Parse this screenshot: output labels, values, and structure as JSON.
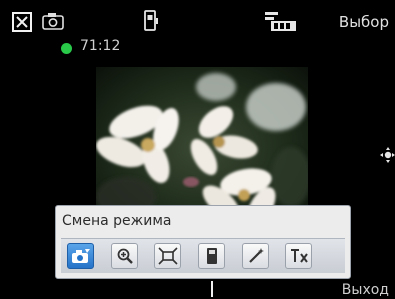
{
  "topbar": {
    "close_icon": "close-x-icon",
    "camera_icon": "camera-icon",
    "memory_icon": "memory-card-icon",
    "resolution_icon": "resolution-icon",
    "select_label": "Выбор"
  },
  "status": {
    "recording_indicator_color": "#29c94a",
    "time_remaining": "71:12"
  },
  "preview": {
    "subject": "flowers"
  },
  "mode_panel": {
    "title": "Смена режима",
    "buttons": [
      {
        "icon": "camera-mode-icon",
        "selected": true
      },
      {
        "icon": "zoom-icon",
        "selected": false
      },
      {
        "icon": "frame-size-icon",
        "selected": false
      },
      {
        "icon": "storage-icon",
        "selected": false
      },
      {
        "icon": "effects-wand-icon",
        "selected": false
      },
      {
        "icon": "settings-tools-icon",
        "selected": false
      }
    ]
  },
  "softkeys": {
    "right_label": "Выход"
  },
  "colors": {
    "accent": "#2573c9",
    "panel_bg": "#ececec"
  }
}
